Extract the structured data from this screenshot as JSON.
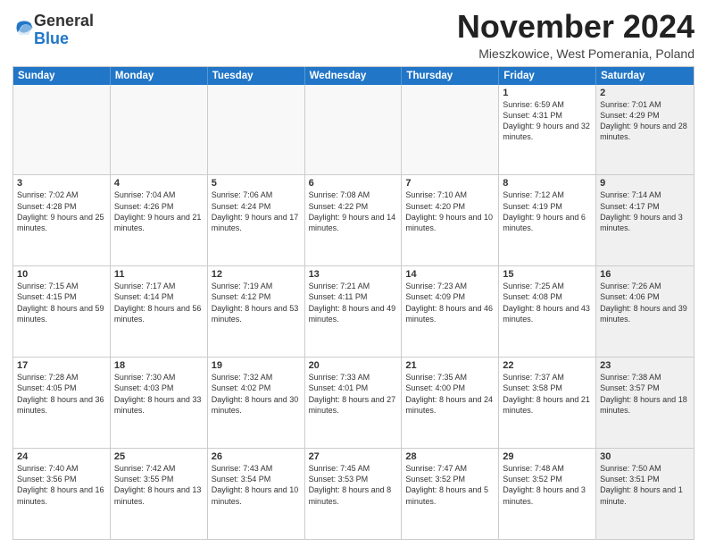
{
  "logo": {
    "general": "General",
    "blue": "Blue"
  },
  "title": "November 2024",
  "location": "Mieszkowice, West Pomerania, Poland",
  "header_days": [
    "Sunday",
    "Monday",
    "Tuesday",
    "Wednesday",
    "Thursday",
    "Friday",
    "Saturday"
  ],
  "rows": [
    [
      {
        "day": "",
        "info": "",
        "shaded": false,
        "empty": true
      },
      {
        "day": "",
        "info": "",
        "shaded": false,
        "empty": true
      },
      {
        "day": "",
        "info": "",
        "shaded": false,
        "empty": true
      },
      {
        "day": "",
        "info": "",
        "shaded": false,
        "empty": true
      },
      {
        "day": "",
        "info": "",
        "shaded": false,
        "empty": true
      },
      {
        "day": "1",
        "info": "Sunrise: 6:59 AM\nSunset: 4:31 PM\nDaylight: 9 hours and 32 minutes.",
        "shaded": false,
        "empty": false
      },
      {
        "day": "2",
        "info": "Sunrise: 7:01 AM\nSunset: 4:29 PM\nDaylight: 9 hours and 28 minutes.",
        "shaded": true,
        "empty": false
      }
    ],
    [
      {
        "day": "3",
        "info": "Sunrise: 7:02 AM\nSunset: 4:28 PM\nDaylight: 9 hours and 25 minutes.",
        "shaded": false,
        "empty": false
      },
      {
        "day": "4",
        "info": "Sunrise: 7:04 AM\nSunset: 4:26 PM\nDaylight: 9 hours and 21 minutes.",
        "shaded": false,
        "empty": false
      },
      {
        "day": "5",
        "info": "Sunrise: 7:06 AM\nSunset: 4:24 PM\nDaylight: 9 hours and 17 minutes.",
        "shaded": false,
        "empty": false
      },
      {
        "day": "6",
        "info": "Sunrise: 7:08 AM\nSunset: 4:22 PM\nDaylight: 9 hours and 14 minutes.",
        "shaded": false,
        "empty": false
      },
      {
        "day": "7",
        "info": "Sunrise: 7:10 AM\nSunset: 4:20 PM\nDaylight: 9 hours and 10 minutes.",
        "shaded": false,
        "empty": false
      },
      {
        "day": "8",
        "info": "Sunrise: 7:12 AM\nSunset: 4:19 PM\nDaylight: 9 hours and 6 minutes.",
        "shaded": false,
        "empty": false
      },
      {
        "day": "9",
        "info": "Sunrise: 7:14 AM\nSunset: 4:17 PM\nDaylight: 9 hours and 3 minutes.",
        "shaded": true,
        "empty": false
      }
    ],
    [
      {
        "day": "10",
        "info": "Sunrise: 7:15 AM\nSunset: 4:15 PM\nDaylight: 8 hours and 59 minutes.",
        "shaded": false,
        "empty": false
      },
      {
        "day": "11",
        "info": "Sunrise: 7:17 AM\nSunset: 4:14 PM\nDaylight: 8 hours and 56 minutes.",
        "shaded": false,
        "empty": false
      },
      {
        "day": "12",
        "info": "Sunrise: 7:19 AM\nSunset: 4:12 PM\nDaylight: 8 hours and 53 minutes.",
        "shaded": false,
        "empty": false
      },
      {
        "day": "13",
        "info": "Sunrise: 7:21 AM\nSunset: 4:11 PM\nDaylight: 8 hours and 49 minutes.",
        "shaded": false,
        "empty": false
      },
      {
        "day": "14",
        "info": "Sunrise: 7:23 AM\nSunset: 4:09 PM\nDaylight: 8 hours and 46 minutes.",
        "shaded": false,
        "empty": false
      },
      {
        "day": "15",
        "info": "Sunrise: 7:25 AM\nSunset: 4:08 PM\nDaylight: 8 hours and 43 minutes.",
        "shaded": false,
        "empty": false
      },
      {
        "day": "16",
        "info": "Sunrise: 7:26 AM\nSunset: 4:06 PM\nDaylight: 8 hours and 39 minutes.",
        "shaded": true,
        "empty": false
      }
    ],
    [
      {
        "day": "17",
        "info": "Sunrise: 7:28 AM\nSunset: 4:05 PM\nDaylight: 8 hours and 36 minutes.",
        "shaded": false,
        "empty": false
      },
      {
        "day": "18",
        "info": "Sunrise: 7:30 AM\nSunset: 4:03 PM\nDaylight: 8 hours and 33 minutes.",
        "shaded": false,
        "empty": false
      },
      {
        "day": "19",
        "info": "Sunrise: 7:32 AM\nSunset: 4:02 PM\nDaylight: 8 hours and 30 minutes.",
        "shaded": false,
        "empty": false
      },
      {
        "day": "20",
        "info": "Sunrise: 7:33 AM\nSunset: 4:01 PM\nDaylight: 8 hours and 27 minutes.",
        "shaded": false,
        "empty": false
      },
      {
        "day": "21",
        "info": "Sunrise: 7:35 AM\nSunset: 4:00 PM\nDaylight: 8 hours and 24 minutes.",
        "shaded": false,
        "empty": false
      },
      {
        "day": "22",
        "info": "Sunrise: 7:37 AM\nSunset: 3:58 PM\nDaylight: 8 hours and 21 minutes.",
        "shaded": false,
        "empty": false
      },
      {
        "day": "23",
        "info": "Sunrise: 7:38 AM\nSunset: 3:57 PM\nDaylight: 8 hours and 18 minutes.",
        "shaded": true,
        "empty": false
      }
    ],
    [
      {
        "day": "24",
        "info": "Sunrise: 7:40 AM\nSunset: 3:56 PM\nDaylight: 8 hours and 16 minutes.",
        "shaded": false,
        "empty": false
      },
      {
        "day": "25",
        "info": "Sunrise: 7:42 AM\nSunset: 3:55 PM\nDaylight: 8 hours and 13 minutes.",
        "shaded": false,
        "empty": false
      },
      {
        "day": "26",
        "info": "Sunrise: 7:43 AM\nSunset: 3:54 PM\nDaylight: 8 hours and 10 minutes.",
        "shaded": false,
        "empty": false
      },
      {
        "day": "27",
        "info": "Sunrise: 7:45 AM\nSunset: 3:53 PM\nDaylight: 8 hours and 8 minutes.",
        "shaded": false,
        "empty": false
      },
      {
        "day": "28",
        "info": "Sunrise: 7:47 AM\nSunset: 3:52 PM\nDaylight: 8 hours and 5 minutes.",
        "shaded": false,
        "empty": false
      },
      {
        "day": "29",
        "info": "Sunrise: 7:48 AM\nSunset: 3:52 PM\nDaylight: 8 hours and 3 minutes.",
        "shaded": false,
        "empty": false
      },
      {
        "day": "30",
        "info": "Sunrise: 7:50 AM\nSunset: 3:51 PM\nDaylight: 8 hours and 1 minute.",
        "shaded": true,
        "empty": false
      }
    ]
  ]
}
